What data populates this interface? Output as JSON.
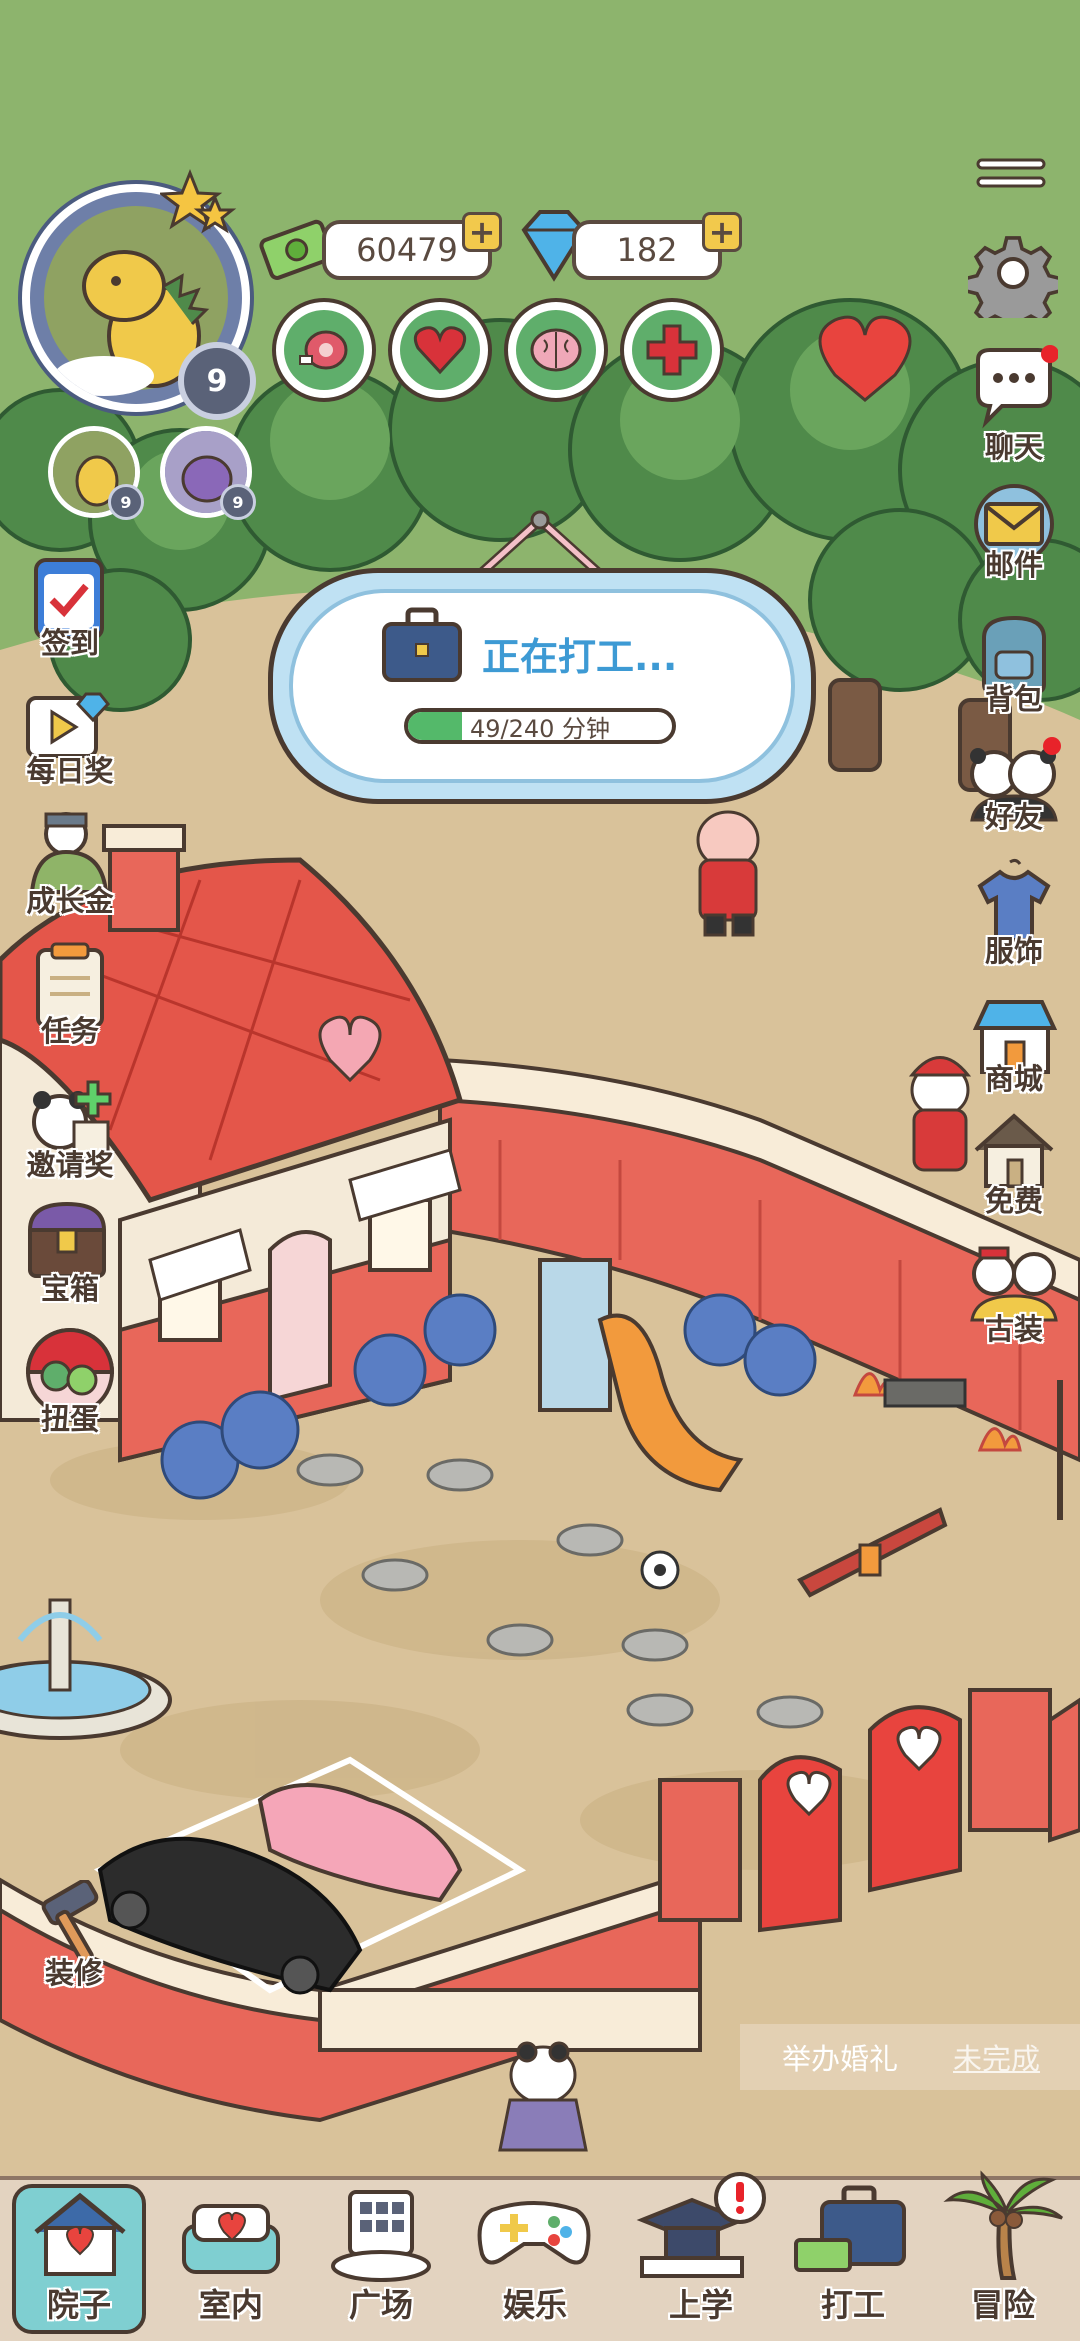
{
  "player": {
    "level": "9",
    "pets": [
      {
        "level": "9"
      },
      {
        "level": "9"
      }
    ]
  },
  "currency": {
    "coins": "60479",
    "gems": "182"
  },
  "stats": [
    "meat-icon",
    "heart-icon",
    "brain-icon",
    "health-cross-icon"
  ],
  "left_menu": {
    "checkin": "签到",
    "daily_reward": "每日奖",
    "growth_fund": "成长金",
    "tasks": "任务",
    "invite_reward": "邀请奖",
    "treasure_chest": "宝箱",
    "gacha": "扭蛋",
    "decorate": "装修"
  },
  "right_menu": {
    "chat": "聊天",
    "mail": "邮件",
    "backpack": "背包",
    "friends": "好友",
    "clothing": "服饰",
    "shop": "商城",
    "free": "免费",
    "ancient_costume": "古装"
  },
  "work_status": {
    "title": "正在打工...",
    "progress_text": "49/240 分钟",
    "progress": 0.204
  },
  "quest": {
    "name": "举办婚礼",
    "status": "未完成"
  },
  "nav": {
    "yard": "院子",
    "indoor": "室内",
    "plaza": "广场",
    "entertainment": "娱乐",
    "school": "上学",
    "work": "打工",
    "adventure": "冒险"
  },
  "colors": {
    "grass": "#8db46d",
    "ground": "#d9c29a",
    "roof": "#e4564a",
    "accent_green": "#5fae6b",
    "progress": "#54b96a"
  }
}
